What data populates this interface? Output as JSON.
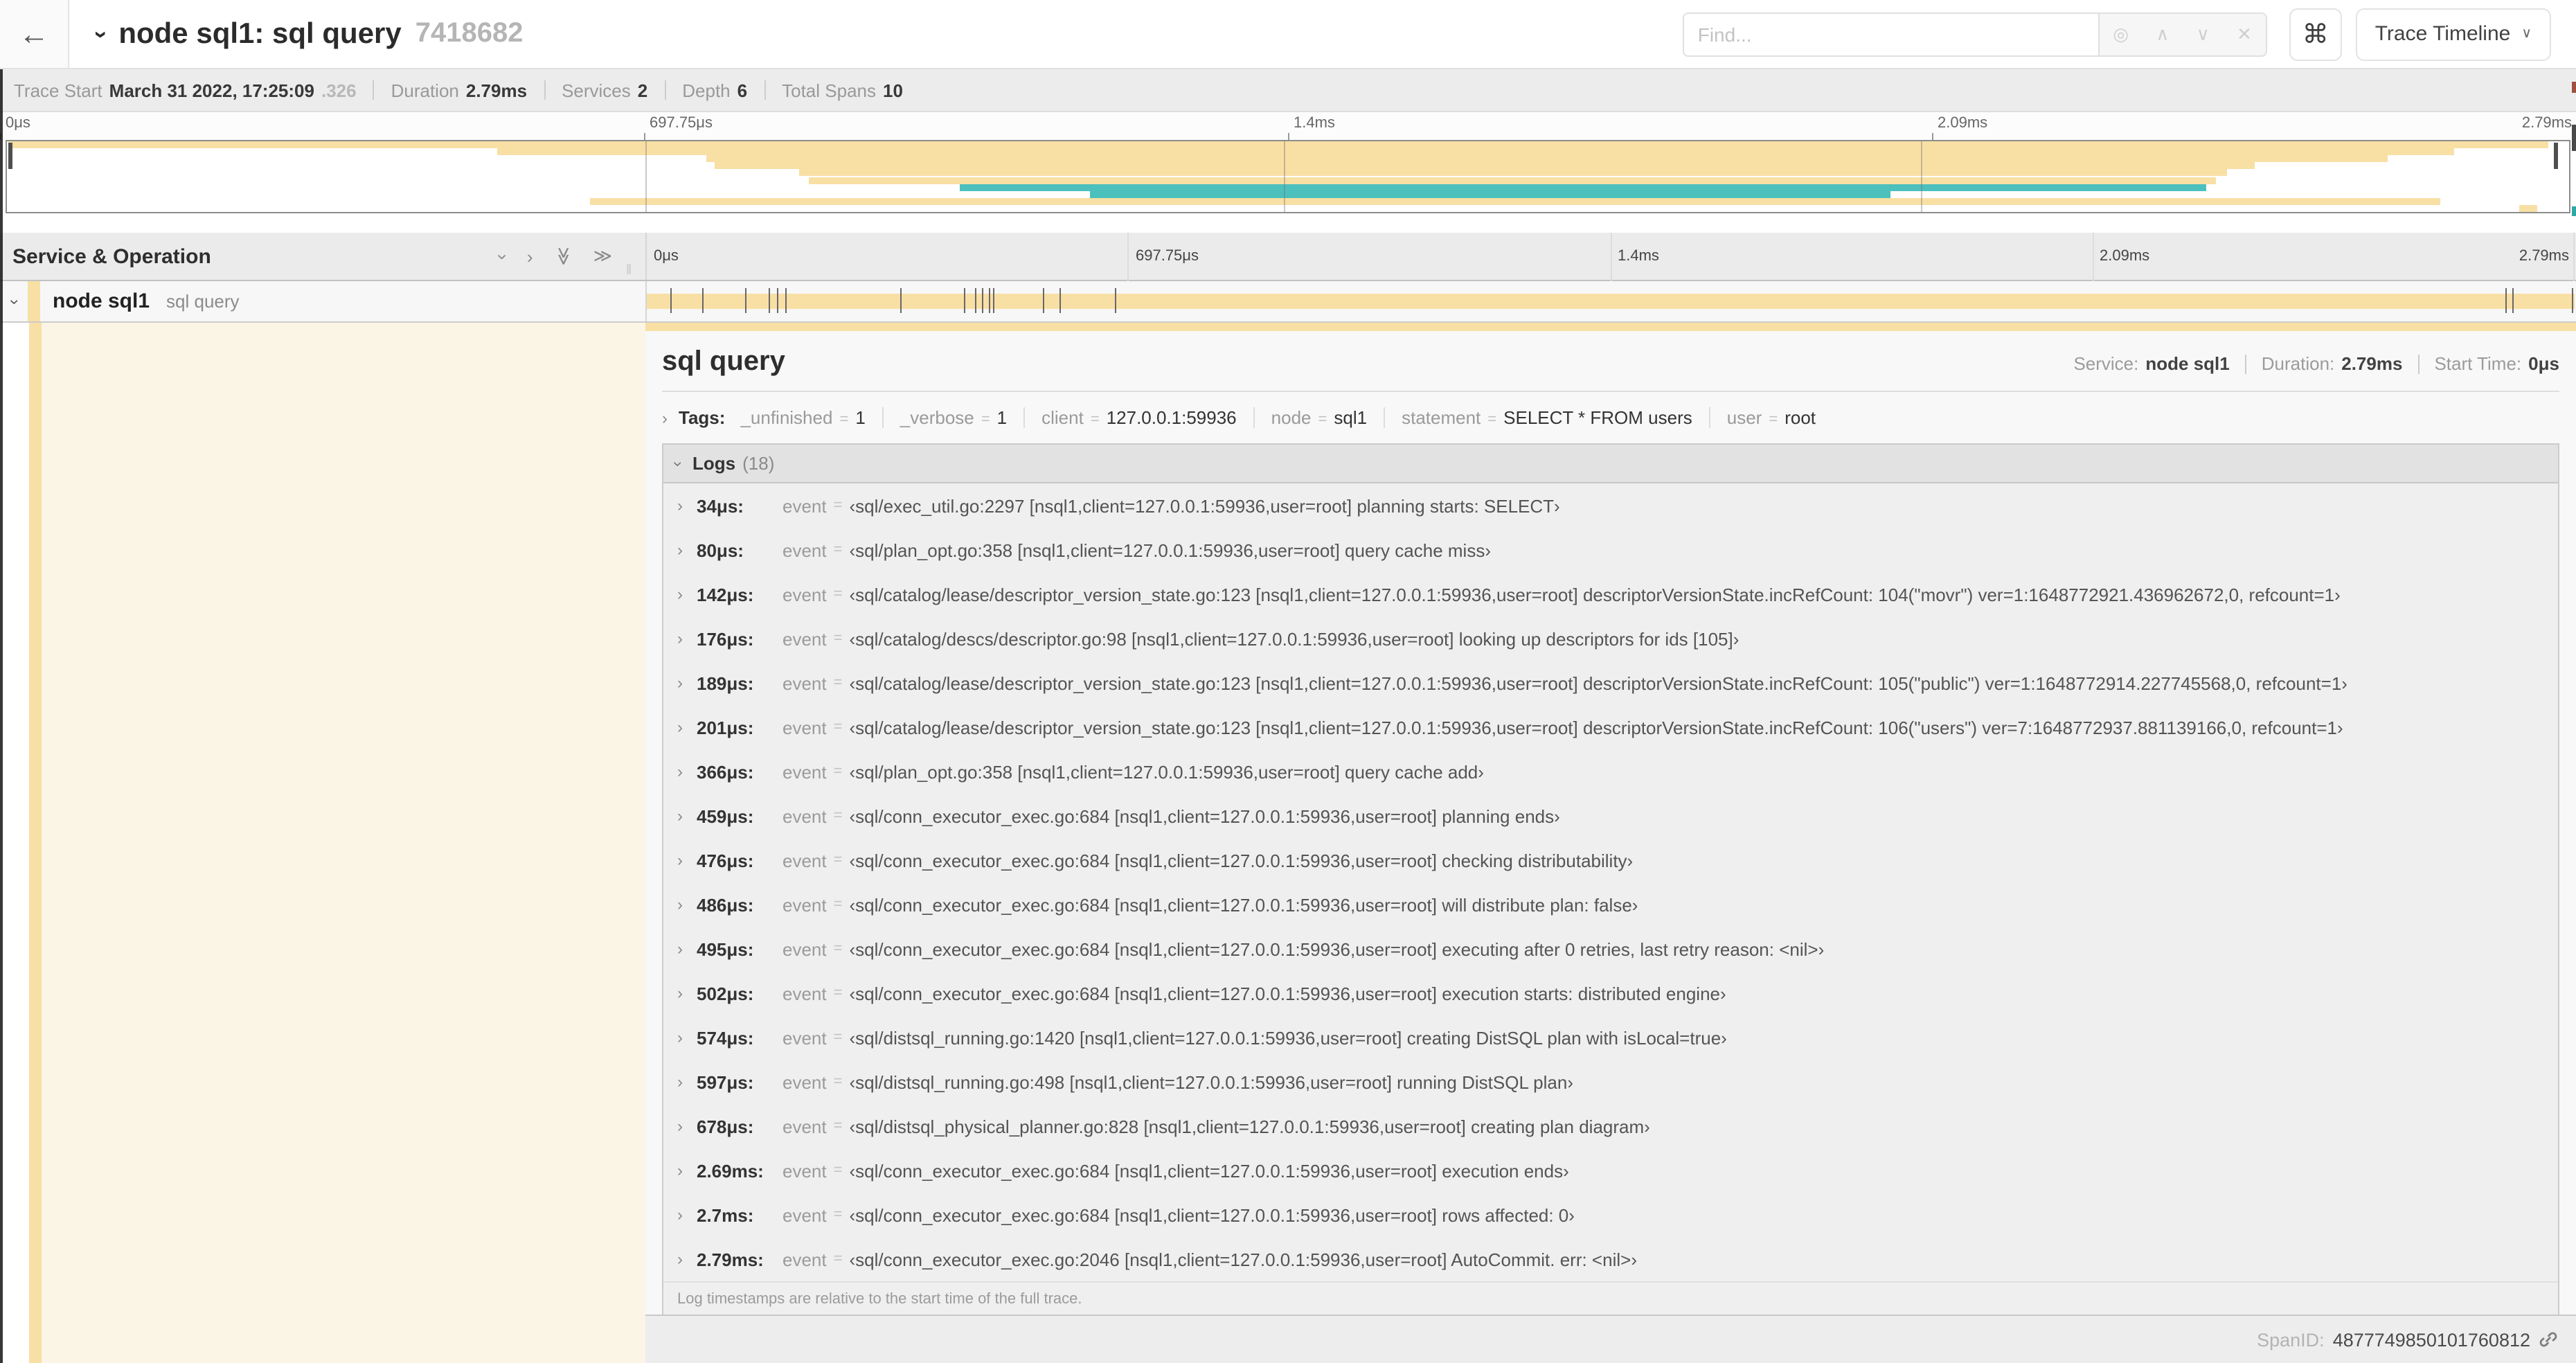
{
  "colors": {
    "tan": "#f8dfa4",
    "teal": "#4cc0bd"
  },
  "icons": {
    "back": "←",
    "chevron": "›",
    "double_chevron": "≫",
    "locate": "◎",
    "caret_up": "∧",
    "caret_down": "∨",
    "close": "✕",
    "command": "⌘",
    "grip": "‖"
  },
  "topbar": {
    "title": "node sql1: sql query",
    "trace_id": "7418682",
    "find_placeholder": "Find...",
    "view_button_label": "Trace Timeline"
  },
  "summary": {
    "items": [
      {
        "label": "Trace Start",
        "value": "March 31 2022, 17:25:09",
        "suffix": ".326"
      },
      {
        "label": "Duration",
        "value": "2.79ms",
        "suffix": ""
      },
      {
        "label": "Services",
        "value": "2",
        "suffix": ""
      },
      {
        "label": "Depth",
        "value": "6",
        "suffix": ""
      },
      {
        "label": "Total Spans",
        "value": "10",
        "suffix": ""
      }
    ]
  },
  "time_ticks": [
    {
      "label": "0μs",
      "pct": 0
    },
    {
      "label": "697.75μs",
      "pct": 25
    },
    {
      "label": "1.4ms",
      "pct": 50
    },
    {
      "label": "2.09ms",
      "pct": 75
    },
    {
      "label": "2.79ms",
      "pct": 100
    }
  ],
  "minimap": {
    "grid_pcts": [
      25,
      50,
      75
    ],
    "spans": [
      {
        "start": 0,
        "end": 99.6,
        "color": "tan"
      },
      {
        "start": 19.2,
        "end": 95.9,
        "color": "tan"
      },
      {
        "start": 27.4,
        "end": 93.3,
        "color": "tan"
      },
      {
        "start": 27.7,
        "end": 88.1,
        "color": "tan"
      },
      {
        "start": 31.0,
        "end": 87.0,
        "color": "tan"
      },
      {
        "start": 31.4,
        "end": 86.6,
        "color": "tan"
      },
      {
        "start": 37.3,
        "end": 86.2,
        "color": "teal"
      },
      {
        "start": 42.4,
        "end": 73.8,
        "color": "teal"
      },
      {
        "start": 22.8,
        "end": 95.4,
        "color": "tan"
      },
      {
        "start": 98.5,
        "end": 99.2,
        "color": "tan"
      }
    ]
  },
  "timeline_header": {
    "title": "Service & Operation",
    "grid_pcts": [
      25,
      50,
      75,
      100
    ]
  },
  "span_row": {
    "service": "node sql1",
    "operation": "sql query",
    "log_marker_pcts": [
      1.22,
      2.87,
      5.09,
      6.31,
      6.78,
      7.2,
      13.12,
      16.45,
      17.06,
      17.42,
      17.74,
      17.99,
      20.57,
      21.4,
      24.3,
      96.42,
      96.77,
      99.85
    ]
  },
  "detail": {
    "title": "sql query",
    "header_fields": [
      {
        "label": "Service:",
        "value": "node sql1"
      },
      {
        "label": "Duration:",
        "value": "2.79ms"
      },
      {
        "label": "Start Time:",
        "value": "0μs"
      }
    ],
    "tags_label": "Tags:",
    "equals": "=",
    "tags": [
      {
        "key": "_unfinished",
        "value": "1"
      },
      {
        "key": "_verbose",
        "value": "1"
      },
      {
        "key": "client",
        "value": "127.0.0.1:59936"
      },
      {
        "key": "node",
        "value": "sql1"
      },
      {
        "key": "statement",
        "value": "SELECT * FROM users"
      },
      {
        "key": "user",
        "value": "root"
      }
    ],
    "logs": {
      "label": "Logs",
      "count": "(18)",
      "field_key": "event",
      "entries": [
        {
          "time": "34μs:",
          "value": "‹sql/exec_util.go:2297 [nsql1,client=127.0.0.1:59936,user=root] planning starts: SELECT›"
        },
        {
          "time": "80μs:",
          "value": "‹sql/plan_opt.go:358 [nsql1,client=127.0.0.1:59936,user=root] query cache miss›"
        },
        {
          "time": "142μs:",
          "value": "‹sql/catalog/lease/descriptor_version_state.go:123 [nsql1,client=127.0.0.1:59936,user=root] descriptorVersionState.incRefCount: 104(\"movr\") ver=1:1648772921.436962672,0, refcount=1›"
        },
        {
          "time": "176μs:",
          "value": "‹sql/catalog/descs/descriptor.go:98 [nsql1,client=127.0.0.1:59936,user=root] looking up descriptors for ids [105]›"
        },
        {
          "time": "189μs:",
          "value": "‹sql/catalog/lease/descriptor_version_state.go:123 [nsql1,client=127.0.0.1:59936,user=root] descriptorVersionState.incRefCount: 105(\"public\") ver=1:1648772914.227745568,0, refcount=1›"
        },
        {
          "time": "201μs:",
          "value": "‹sql/catalog/lease/descriptor_version_state.go:123 [nsql1,client=127.0.0.1:59936,user=root] descriptorVersionState.incRefCount: 106(\"users\") ver=7:1648772937.881139166,0, refcount=1›"
        },
        {
          "time": "366μs:",
          "value": "‹sql/plan_opt.go:358 [nsql1,client=127.0.0.1:59936,user=root] query cache add›"
        },
        {
          "time": "459μs:",
          "value": "‹sql/conn_executor_exec.go:684 [nsql1,client=127.0.0.1:59936,user=root] planning ends›"
        },
        {
          "time": "476μs:",
          "value": "‹sql/conn_executor_exec.go:684 [nsql1,client=127.0.0.1:59936,user=root] checking distributability›"
        },
        {
          "time": "486μs:",
          "value": "‹sql/conn_executor_exec.go:684 [nsql1,client=127.0.0.1:59936,user=root] will distribute plan: false›"
        },
        {
          "time": "495μs:",
          "value": "‹sql/conn_executor_exec.go:684 [nsql1,client=127.0.0.1:59936,user=root] executing after 0 retries, last retry reason: <nil>›"
        },
        {
          "time": "502μs:",
          "value": "‹sql/conn_executor_exec.go:684 [nsql1,client=127.0.0.1:59936,user=root] execution starts: distributed engine›"
        },
        {
          "time": "574μs:",
          "value": "‹sql/distsql_running.go:1420 [nsql1,client=127.0.0.1:59936,user=root] creating DistSQL plan with isLocal=true›"
        },
        {
          "time": "597μs:",
          "value": "‹sql/distsql_running.go:498 [nsql1,client=127.0.0.1:59936,user=root] running DistSQL plan›"
        },
        {
          "time": "678μs:",
          "value": "‹sql/distsql_physical_planner.go:828 [nsql1,client=127.0.0.1:59936,user=root] creating plan diagram›"
        },
        {
          "time": "2.69ms:",
          "value": "‹sql/conn_executor_exec.go:684 [nsql1,client=127.0.0.1:59936,user=root] execution ends›"
        },
        {
          "time": "2.7ms:",
          "value": "‹sql/conn_executor_exec.go:684 [nsql1,client=127.0.0.1:59936,user=root] rows affected: 0›"
        },
        {
          "time": "2.79ms:",
          "value": "‹sql/conn_executor_exec.go:2046 [nsql1,client=127.0.0.1:59936,user=root] AutoCommit. err: <nil>›"
        }
      ],
      "note": "Log timestamps are relative to the start time of the full trace."
    },
    "span_id_label": "SpanID:",
    "span_id": "4877749850101760812"
  }
}
